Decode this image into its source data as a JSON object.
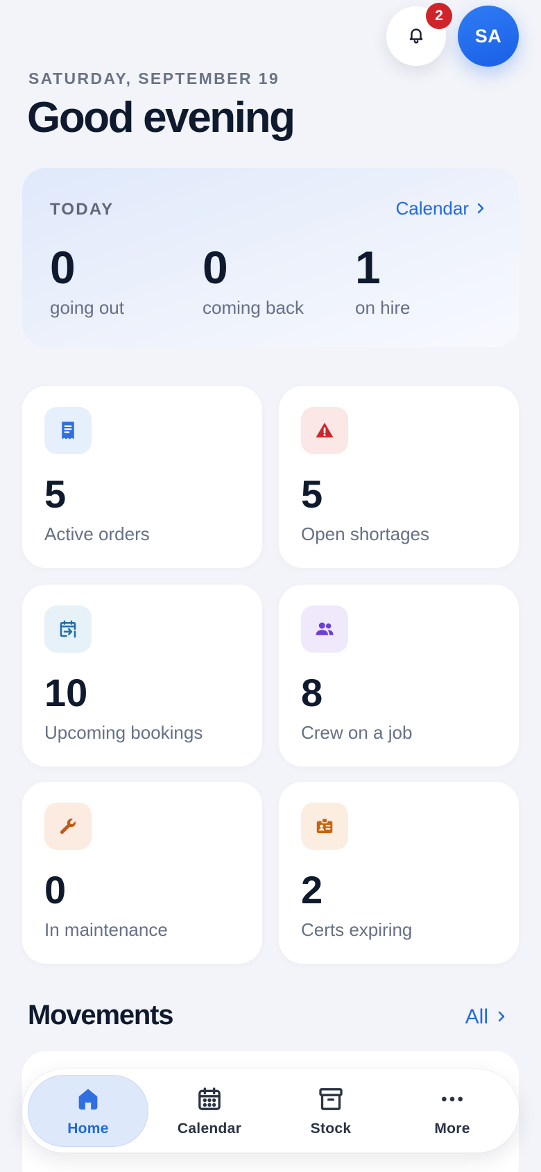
{
  "header": {
    "notifications_count": "2",
    "avatar_initials": "SA",
    "date": "SATURDAY, SEPTEMBER 19",
    "greeting": "Good evening"
  },
  "today": {
    "label": "TODAY",
    "link_label": "Calendar",
    "stats": [
      {
        "value": "0",
        "label": "going out"
      },
      {
        "value": "0",
        "label": "coming back"
      },
      {
        "value": "1",
        "label": "on hire"
      }
    ]
  },
  "kpis": [
    {
      "value": "5",
      "label": "Active orders",
      "icon": "receipt-icon",
      "color": "#2f6fe0",
      "bg": "#e6effc"
    },
    {
      "value": "5",
      "label": "Open shortages",
      "icon": "warning-icon",
      "color": "#d0242b",
      "bg": "#fbe7e6"
    },
    {
      "value": "10",
      "label": "Upcoming bookings",
      "icon": "calendar-arrow-icon",
      "color": "#1f6fa8",
      "bg": "#e6f1f8"
    },
    {
      "value": "8",
      "label": "Crew on a job",
      "icon": "people-icon",
      "color": "#6a3fd6",
      "bg": "#efe9fb"
    },
    {
      "value": "0",
      "label": "In maintenance",
      "icon": "wrench-icon",
      "color": "#c25a12",
      "bg": "#fbebe0"
    },
    {
      "value": "2",
      "label": "Certs expiring",
      "icon": "id-badge-icon",
      "color": "#c8650f",
      "bg": "#fbede0"
    }
  ],
  "movements": {
    "title": "Movements",
    "link_label": "All"
  },
  "nav": [
    {
      "label": "Home",
      "icon": "home-icon",
      "active": true
    },
    {
      "label": "Calendar",
      "icon": "calendar-icon",
      "active": false
    },
    {
      "label": "Stock",
      "icon": "box-icon",
      "active": false
    },
    {
      "label": "More",
      "icon": "more-icon",
      "active": false
    }
  ],
  "colors": {
    "accent": "#2069e0",
    "badge": "#d0242b",
    "text_primary": "#0f1a2e",
    "text_secondary": "#667085",
    "background": "#f2f4f9"
  }
}
